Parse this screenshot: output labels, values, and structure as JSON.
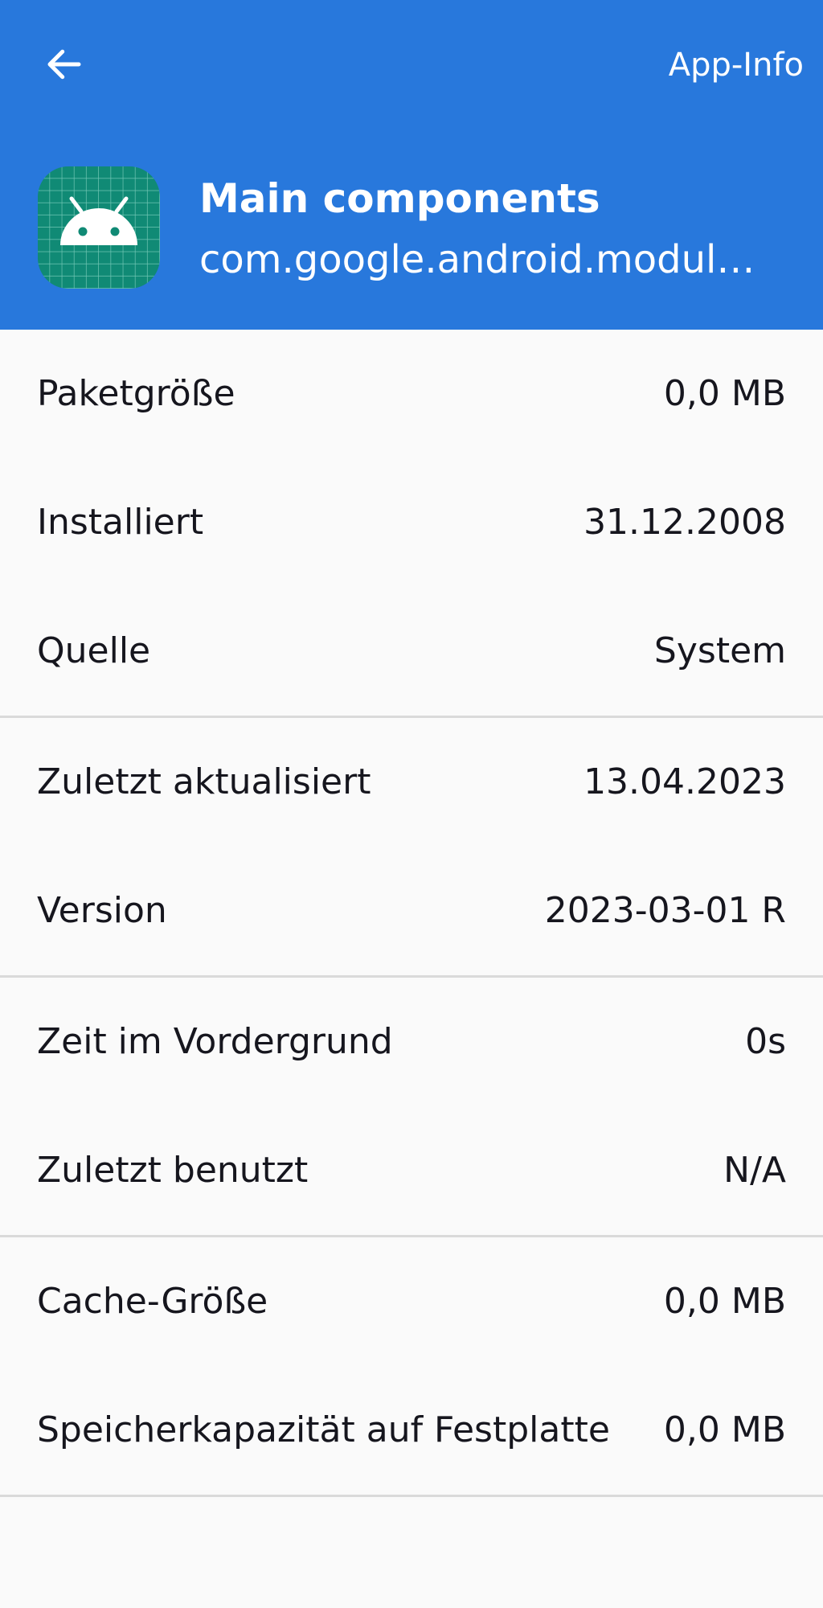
{
  "header": {
    "title": "App-Info",
    "back_icon": "arrow-left-icon",
    "background_color": "#2878dc"
  },
  "app": {
    "name": "Main components",
    "package": "com.google.android.module…",
    "icon": "android-robot-icon",
    "icon_color": "#108a75"
  },
  "groups": [
    {
      "rows": [
        {
          "label": "Paketgröße",
          "value": "0,0 MB"
        },
        {
          "label": "Installiert",
          "value": "31.12.2008"
        },
        {
          "label": "Quelle",
          "value": "System"
        }
      ]
    },
    {
      "rows": [
        {
          "label": "Zuletzt aktualisiert",
          "value": "13.04.2023"
        },
        {
          "label": "Version",
          "value": "2023-03-01 R"
        }
      ]
    },
    {
      "rows": [
        {
          "label": "Zeit im Vordergrund",
          "value": "0s"
        },
        {
          "label": "Zuletzt benutzt",
          "value": "N/A"
        }
      ]
    },
    {
      "rows": [
        {
          "label": "Cache-Größe",
          "value": "0,0 MB"
        },
        {
          "label": "Speicherkapazität auf Festplatte",
          "value": "0,0 MB"
        }
      ]
    }
  ]
}
